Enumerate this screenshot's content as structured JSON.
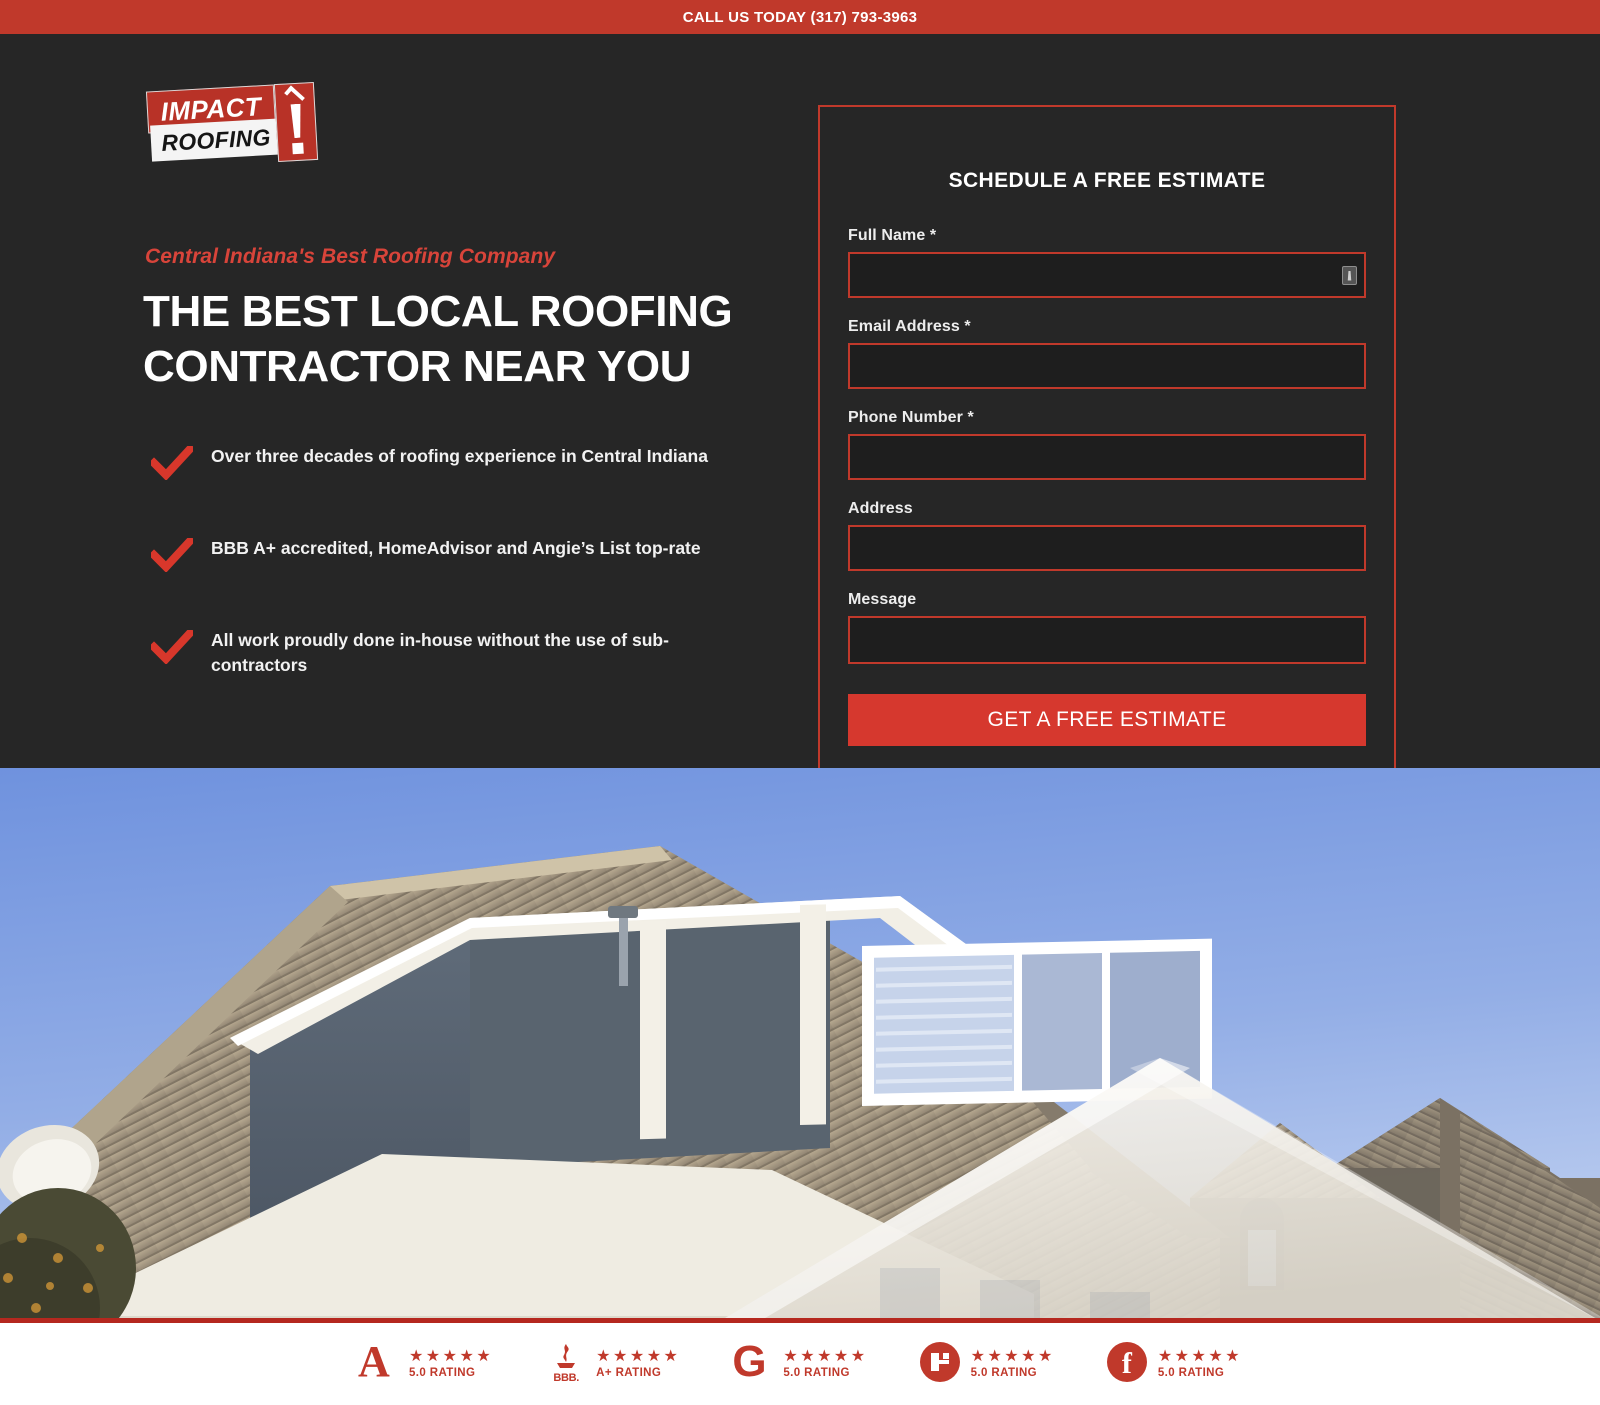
{
  "topbar": {
    "call_text": "CALL US TODAY (317) 793-3963"
  },
  "brand": {
    "logo_line1": "IMPACT",
    "logo_line2": "ROOFING",
    "logo_mark": "exclamation-roof-mark"
  },
  "hero": {
    "eyebrow": "Central Indiana's Best Roofing Company",
    "headline": "THE BEST LOCAL ROOFING CONTRACTOR NEAR YOU",
    "bullets": [
      "Over three decades of roofing experience in Central Indiana",
      "BBB A+ accredited, HomeAdvisor and Angie’s List top-rate",
      "All work proudly done in-house without the use of sub-contractors"
    ]
  },
  "form": {
    "title": "SCHEDULE A FREE ESTIMATE",
    "fields": [
      {
        "label": "Full Name *",
        "value": "",
        "placeholder": "",
        "type": "text",
        "name": "full-name"
      },
      {
        "label": "Email Address *",
        "value": "",
        "placeholder": "",
        "type": "email",
        "name": "email-address"
      },
      {
        "label": "Phone Number *",
        "value": "",
        "placeholder": "",
        "type": "tel",
        "name": "phone-number"
      },
      {
        "label": "Address",
        "value": "",
        "placeholder": "",
        "type": "text",
        "name": "address"
      },
      {
        "label": "Message",
        "value": "",
        "placeholder": "",
        "type": "textarea",
        "name": "message"
      }
    ],
    "submit_label": "GET A FREE ESTIMATE"
  },
  "badges": [
    {
      "mark": "angies-list-logo",
      "glyph": "A",
      "stars": "★★★★★",
      "rating": "5.0 RATING"
    },
    {
      "mark": "bbb-logo",
      "glyph": "BBB.",
      "stars": "★★★★★",
      "rating": "A+ RATING"
    },
    {
      "mark": "google-logo",
      "glyph": "G",
      "stars": "★★★★★",
      "rating": "5.0 RATING"
    },
    {
      "mark": "homeadvisor-logo",
      "glyph": "H",
      "stars": "★★★★★",
      "rating": "5.0 RATING"
    },
    {
      "mark": "facebook-logo",
      "glyph": "f",
      "stars": "★★★★★",
      "rating": "5.0 RATING"
    }
  ],
  "colors": {
    "brand_red": "#c0392b",
    "bright_red": "#d6382e",
    "dark_panel": "#262626",
    "sky_blue": "#7d9ee0",
    "text_light": "#f2f2f2"
  },
  "photo": {
    "alt": "two-story-house-with-tile-roof-photo"
  }
}
